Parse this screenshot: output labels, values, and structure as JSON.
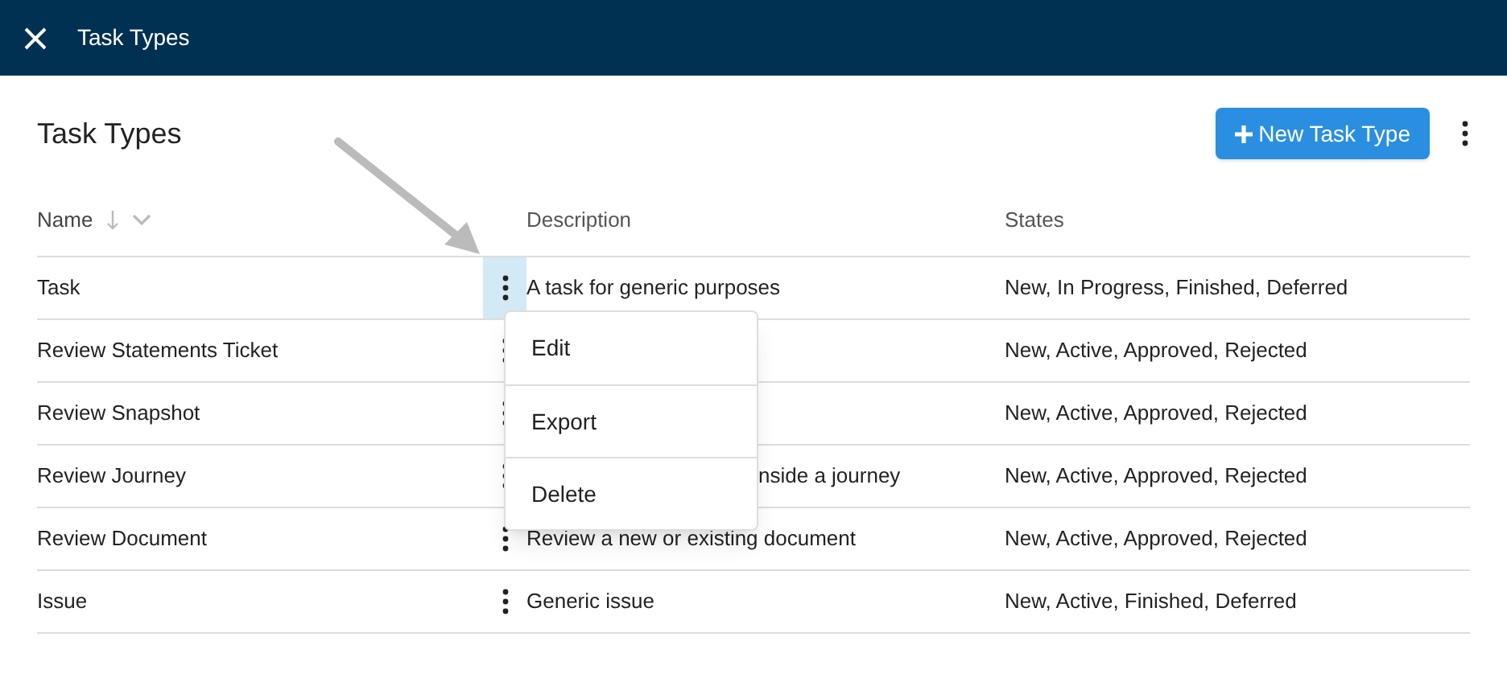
{
  "top_bar": {
    "title": "Task Types"
  },
  "page": {
    "title": "Task Types",
    "new_button": "New Task Type"
  },
  "table": {
    "columns": [
      {
        "label": "Name",
        "sorted": true
      },
      {
        "label": "Description",
        "sorted": false
      },
      {
        "label": "States",
        "sorted": false
      }
    ],
    "rows": [
      {
        "name": "Task",
        "description": "A task for generic purposes",
        "states": "New, In Progress, Finished, Deferred",
        "selected": true,
        "kind": "plain"
      },
      {
        "name": "Review Statements Ticket",
        "states": "New, Active, Approved, Rejected",
        "selected": false,
        "kind": "plain"
      },
      {
        "name": "Review Snapshot",
        "states": "New, Active, Approved, Rejected",
        "selected": false,
        "kind": "plain"
      },
      {
        "name": "Review Journey",
        "description": "nside a journey",
        "states": "New, Active, Approved, Rejected",
        "selected": false,
        "kind": "partial"
      },
      {
        "name": "Review Document",
        "description": "Review a new or existing document",
        "states": "New, Active, Approved, Rejected",
        "selected": false,
        "kind": "plain"
      },
      {
        "name": "Issue",
        "description": "Generic issue",
        "states": "New, Active, Finished, Deferred",
        "selected": false,
        "kind": "plain"
      }
    ]
  },
  "row_menu": {
    "items": [
      "Edit",
      "Export",
      "Delete"
    ]
  }
}
